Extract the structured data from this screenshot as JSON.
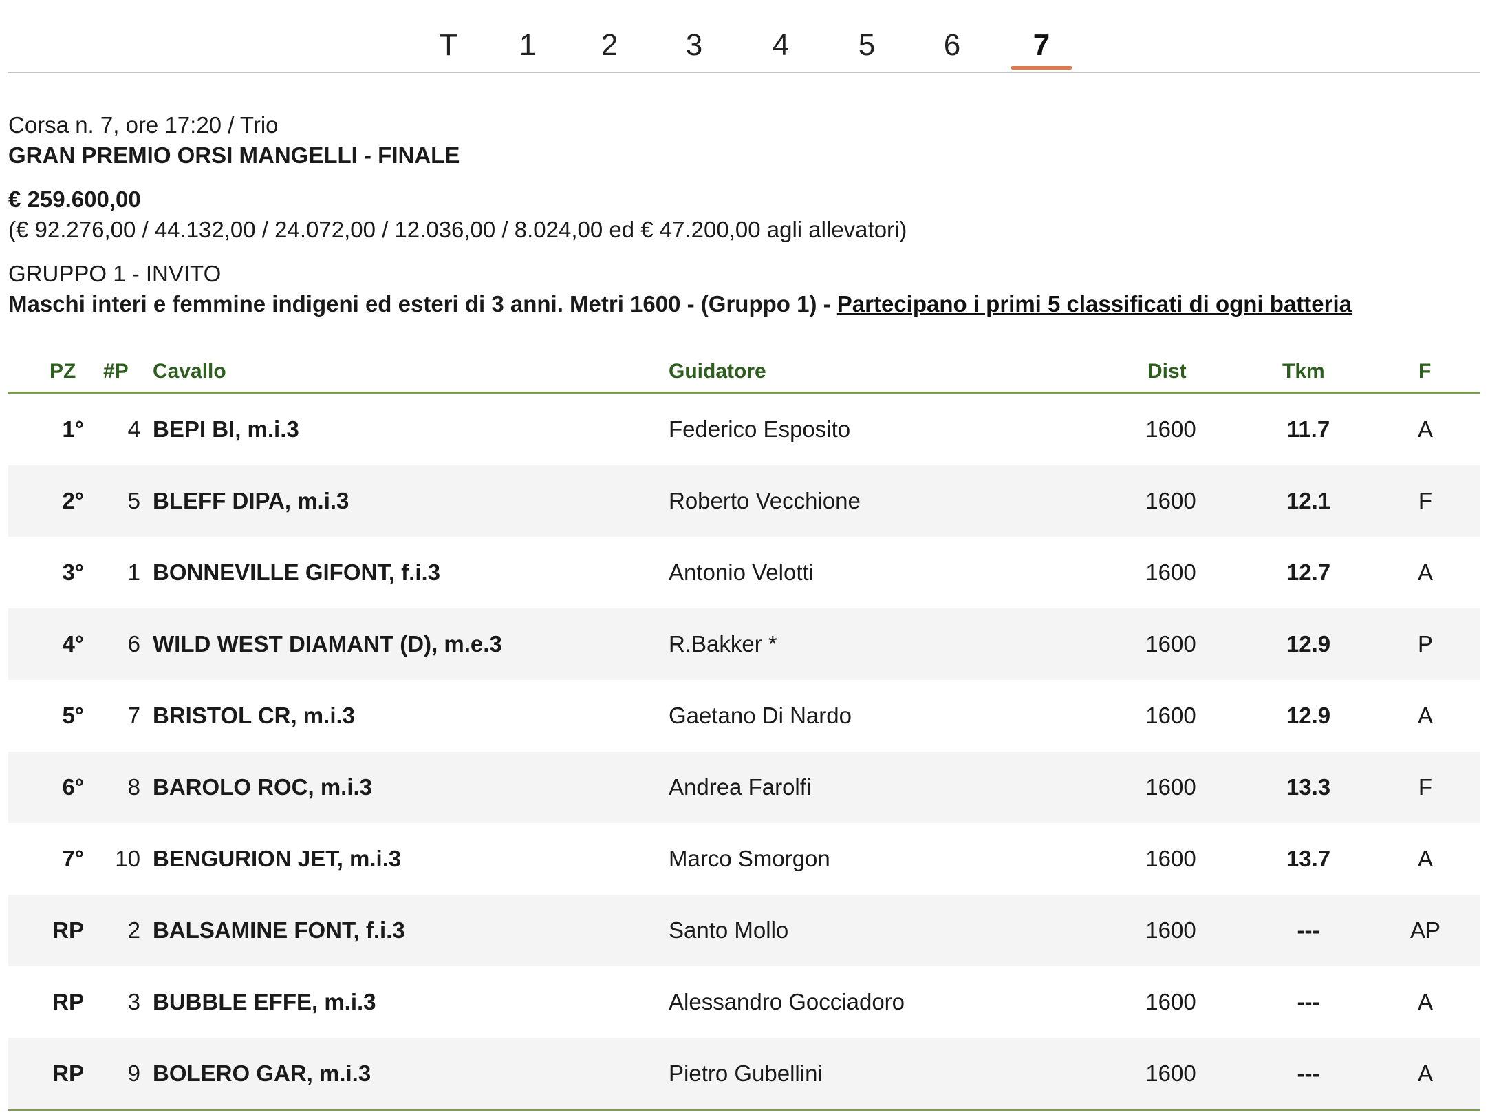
{
  "tabs": [
    "T",
    "1",
    "2",
    "3",
    "4",
    "5",
    "6",
    "7"
  ],
  "active_tab": "7",
  "race": {
    "header": "Corsa n. 7, ore 17:20 / Trio",
    "title": "GRAN PREMIO ORSI MANGELLI - FINALE",
    "prize": "€ 259.600,00",
    "prize_breakdown": "(€ 92.276,00 / 44.132,00 / 24.072,00 / 12.036,00 / 8.024,00 ed € 47.200,00 agli allevatori)",
    "group": "GRUPPO 1 - INVITO",
    "conditions": "Maschi interi e femmine indigeni ed esteri di 3 anni. Metri 1600 - (Gruppo 1) - ",
    "conditions_link": "Partecipano i primi 5 classificati di ogni batteria"
  },
  "table": {
    "headers": {
      "pz": "PZ",
      "np": "#P",
      "horse": "Cavallo",
      "driver": "Guidatore",
      "dist": "Dist",
      "tkm": "Tkm",
      "f": "F"
    },
    "rows": [
      {
        "pz": "1°",
        "np": "4",
        "horse": "BEPI BI, m.i.3",
        "driver": "Federico Esposito",
        "dist": "1600",
        "tkm": "11.7",
        "f": "A"
      },
      {
        "pz": "2°",
        "np": "5",
        "horse": "BLEFF DIPA, m.i.3",
        "driver": "Roberto Vecchione",
        "dist": "1600",
        "tkm": "12.1",
        "f": "F"
      },
      {
        "pz": "3°",
        "np": "1",
        "horse": "BONNEVILLE GIFONT, f.i.3",
        "driver": "Antonio Velotti",
        "dist": "1600",
        "tkm": "12.7",
        "f": "A"
      },
      {
        "pz": "4°",
        "np": "6",
        "horse": "WILD WEST DIAMANT (D), m.e.3",
        "driver": "R.Bakker *",
        "dist": "1600",
        "tkm": "12.9",
        "f": "P"
      },
      {
        "pz": "5°",
        "np": "7",
        "horse": "BRISTOL CR, m.i.3",
        "driver": "Gaetano Di Nardo",
        "dist": "1600",
        "tkm": "12.9",
        "f": "A"
      },
      {
        "pz": "6°",
        "np": "8",
        "horse": "BAROLO ROC, m.i.3",
        "driver": "Andrea Farolfi",
        "dist": "1600",
        "tkm": "13.3",
        "f": "F"
      },
      {
        "pz": "7°",
        "np": "10",
        "horse": "BENGURION JET, m.i.3",
        "driver": "Marco Smorgon",
        "dist": "1600",
        "tkm": "13.7",
        "f": "A"
      },
      {
        "pz": "RP",
        "np": "2",
        "horse": "BALSAMINE FONT, f.i.3",
        "driver": "Santo Mollo",
        "dist": "1600",
        "tkm": "---",
        "f": "AP"
      },
      {
        "pz": "RP",
        "np": "3",
        "horse": "BUBBLE EFFE, m.i.3",
        "driver": "Alessandro Gocciadoro",
        "dist": "1600",
        "tkm": "---",
        "f": "A"
      },
      {
        "pz": "RP",
        "np": "9",
        "horse": "BOLERO GAR, m.i.3",
        "driver": "Pietro Gubellini",
        "dist": "1600",
        "tkm": "---",
        "f": "A"
      }
    ]
  },
  "colors": {
    "header_text": "#2e5e1e",
    "rule": "#7a9e4f",
    "active_tab_underline": "#e0784e",
    "alt_row": "#f4f4f4"
  }
}
